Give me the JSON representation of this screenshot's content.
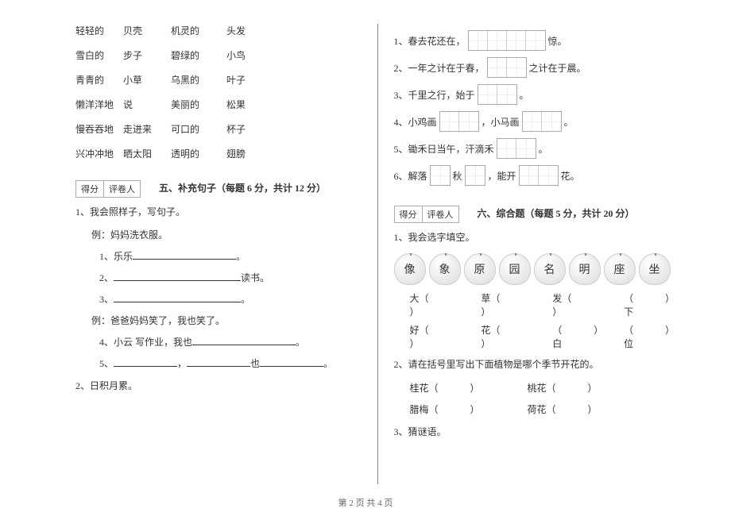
{
  "wordPairs": {
    "r1c1": "轻轻的",
    "r1c2": "贝壳",
    "r1c3": "机灵的",
    "r1c4": "头发",
    "r2c1": "雪白的",
    "r2c2": "步子",
    "r2c3": "碧绿的",
    "r2c4": "小鸟",
    "r3c1": "青青的",
    "r3c2": "小草",
    "r3c3": "乌黑的",
    "r3c4": "叶子",
    "r4c1": "懒洋洋地",
    "r4c2": "说",
    "r4c3": "美丽的",
    "r4c4": "松果",
    "r5c1": "慢吞吞地",
    "r5c2": "走进来",
    "r5c3": "可口的",
    "r5c4": "杯子",
    "r6c1": "兴冲冲地",
    "r6c2": "晒太阳",
    "r6c3": "透明的",
    "r6c4": "翅膀"
  },
  "score": {
    "label1": "得分",
    "label2": "评卷人"
  },
  "section5": {
    "title": "五、补充句子（每题 6 分，共计 12 分）",
    "q1": "1、我会照样子，写句子。",
    "ex1": "例：妈妈洗衣服。",
    "s1": "1、乐乐",
    "s1end": "。",
    "s2": "2、",
    "s2end": "读书。",
    "s3": "3、",
    "s3end": "。",
    "ex2": "例：爸爸妈妈笑了，我也笑了。",
    "s4": "4、小云 写作业，我也",
    "s4end": "。",
    "s5": "5、",
    "s5mid": "，",
    "s5also": "也",
    "s5end": "。",
    "q2": "2、日积月累。"
  },
  "fills": {
    "f1a": "1、春去花还在，",
    "f1b": "惊。",
    "f2a": "2、一年之计在于春，",
    "f2b": "之计在于晨。",
    "f3a": "3、千里之行，始于",
    "f3b": "。",
    "f4a": "4、小鸡画",
    "f4b": "，小马画",
    "f4c": "。",
    "f5a": "5、锄禾日当午，汗滴禾",
    "f5b": "。",
    "f6a": "6、解落",
    "f6b": "秋",
    "f6c": "，能开",
    "f6d": "花。"
  },
  "section6": {
    "title": "六、综合题（每题 5 分，共计 20 分）",
    "q1": "1、我会选字填空。",
    "apples": [
      "像",
      "象",
      "原",
      "园",
      "名",
      "明",
      "座",
      "坐"
    ],
    "choiceRow1": {
      "c1": "大（",
      "c1e": "）",
      "c2": "草（",
      "c2e": "）",
      "c3": "发（",
      "c3e": "）",
      "c4": "（",
      "c4e": "）下"
    },
    "choiceRow2": {
      "c1": "好（",
      "c1e": "）",
      "c2": "花（",
      "c2e": "）",
      "c3": "（",
      "c3e": "）白",
      "c4": "（",
      "c4e": "）位"
    },
    "q2": "2、请在括号里写出下面植物是哪个季节开花的。",
    "plants": {
      "p1": "桂花（",
      "p2": "桃花（",
      "p3": "腊梅（",
      "p4": "荷花（",
      "pe": "）"
    },
    "q3": "3、猜谜语。"
  },
  "footer": "第 2 页 共 4 页"
}
